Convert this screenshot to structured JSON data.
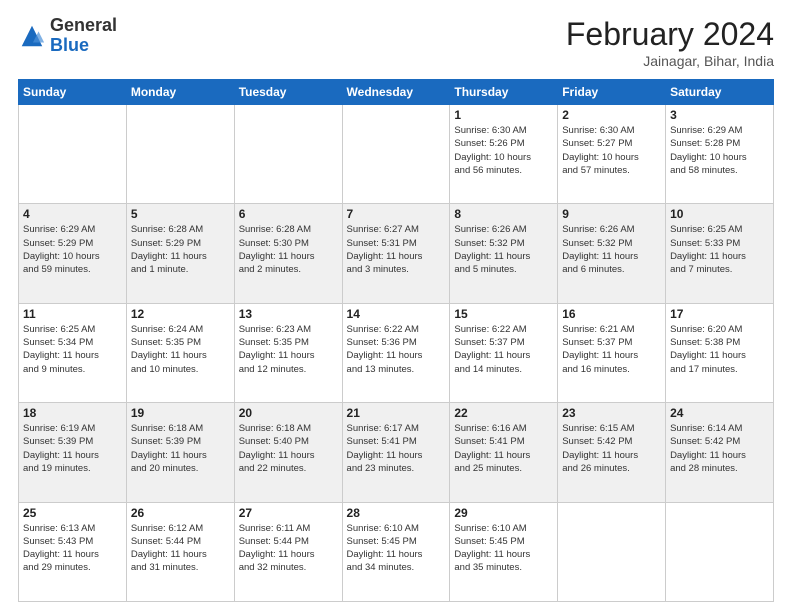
{
  "header": {
    "logo_general": "General",
    "logo_blue": "Blue",
    "month_title": "February 2024",
    "location": "Jainagar, Bihar, India"
  },
  "weekdays": [
    "Sunday",
    "Monday",
    "Tuesday",
    "Wednesday",
    "Thursday",
    "Friday",
    "Saturday"
  ],
  "weeks": [
    [
      {
        "day": "",
        "info": ""
      },
      {
        "day": "",
        "info": ""
      },
      {
        "day": "",
        "info": ""
      },
      {
        "day": "",
        "info": ""
      },
      {
        "day": "1",
        "info": "Sunrise: 6:30 AM\nSunset: 5:26 PM\nDaylight: 10 hours\nand 56 minutes."
      },
      {
        "day": "2",
        "info": "Sunrise: 6:30 AM\nSunset: 5:27 PM\nDaylight: 10 hours\nand 57 minutes."
      },
      {
        "day": "3",
        "info": "Sunrise: 6:29 AM\nSunset: 5:28 PM\nDaylight: 10 hours\nand 58 minutes."
      }
    ],
    [
      {
        "day": "4",
        "info": "Sunrise: 6:29 AM\nSunset: 5:29 PM\nDaylight: 10 hours\nand 59 minutes."
      },
      {
        "day": "5",
        "info": "Sunrise: 6:28 AM\nSunset: 5:29 PM\nDaylight: 11 hours\nand 1 minute."
      },
      {
        "day": "6",
        "info": "Sunrise: 6:28 AM\nSunset: 5:30 PM\nDaylight: 11 hours\nand 2 minutes."
      },
      {
        "day": "7",
        "info": "Sunrise: 6:27 AM\nSunset: 5:31 PM\nDaylight: 11 hours\nand 3 minutes."
      },
      {
        "day": "8",
        "info": "Sunrise: 6:26 AM\nSunset: 5:32 PM\nDaylight: 11 hours\nand 5 minutes."
      },
      {
        "day": "9",
        "info": "Sunrise: 6:26 AM\nSunset: 5:32 PM\nDaylight: 11 hours\nand 6 minutes."
      },
      {
        "day": "10",
        "info": "Sunrise: 6:25 AM\nSunset: 5:33 PM\nDaylight: 11 hours\nand 7 minutes."
      }
    ],
    [
      {
        "day": "11",
        "info": "Sunrise: 6:25 AM\nSunset: 5:34 PM\nDaylight: 11 hours\nand 9 minutes."
      },
      {
        "day": "12",
        "info": "Sunrise: 6:24 AM\nSunset: 5:35 PM\nDaylight: 11 hours\nand 10 minutes."
      },
      {
        "day": "13",
        "info": "Sunrise: 6:23 AM\nSunset: 5:35 PM\nDaylight: 11 hours\nand 12 minutes."
      },
      {
        "day": "14",
        "info": "Sunrise: 6:22 AM\nSunset: 5:36 PM\nDaylight: 11 hours\nand 13 minutes."
      },
      {
        "day": "15",
        "info": "Sunrise: 6:22 AM\nSunset: 5:37 PM\nDaylight: 11 hours\nand 14 minutes."
      },
      {
        "day": "16",
        "info": "Sunrise: 6:21 AM\nSunset: 5:37 PM\nDaylight: 11 hours\nand 16 minutes."
      },
      {
        "day": "17",
        "info": "Sunrise: 6:20 AM\nSunset: 5:38 PM\nDaylight: 11 hours\nand 17 minutes."
      }
    ],
    [
      {
        "day": "18",
        "info": "Sunrise: 6:19 AM\nSunset: 5:39 PM\nDaylight: 11 hours\nand 19 minutes."
      },
      {
        "day": "19",
        "info": "Sunrise: 6:18 AM\nSunset: 5:39 PM\nDaylight: 11 hours\nand 20 minutes."
      },
      {
        "day": "20",
        "info": "Sunrise: 6:18 AM\nSunset: 5:40 PM\nDaylight: 11 hours\nand 22 minutes."
      },
      {
        "day": "21",
        "info": "Sunrise: 6:17 AM\nSunset: 5:41 PM\nDaylight: 11 hours\nand 23 minutes."
      },
      {
        "day": "22",
        "info": "Sunrise: 6:16 AM\nSunset: 5:41 PM\nDaylight: 11 hours\nand 25 minutes."
      },
      {
        "day": "23",
        "info": "Sunrise: 6:15 AM\nSunset: 5:42 PM\nDaylight: 11 hours\nand 26 minutes."
      },
      {
        "day": "24",
        "info": "Sunrise: 6:14 AM\nSunset: 5:42 PM\nDaylight: 11 hours\nand 28 minutes."
      }
    ],
    [
      {
        "day": "25",
        "info": "Sunrise: 6:13 AM\nSunset: 5:43 PM\nDaylight: 11 hours\nand 29 minutes."
      },
      {
        "day": "26",
        "info": "Sunrise: 6:12 AM\nSunset: 5:44 PM\nDaylight: 11 hours\nand 31 minutes."
      },
      {
        "day": "27",
        "info": "Sunrise: 6:11 AM\nSunset: 5:44 PM\nDaylight: 11 hours\nand 32 minutes."
      },
      {
        "day": "28",
        "info": "Sunrise: 6:10 AM\nSunset: 5:45 PM\nDaylight: 11 hours\nand 34 minutes."
      },
      {
        "day": "29",
        "info": "Sunrise: 6:10 AM\nSunset: 5:45 PM\nDaylight: 11 hours\nand 35 minutes."
      },
      {
        "day": "",
        "info": ""
      },
      {
        "day": "",
        "info": ""
      }
    ]
  ]
}
